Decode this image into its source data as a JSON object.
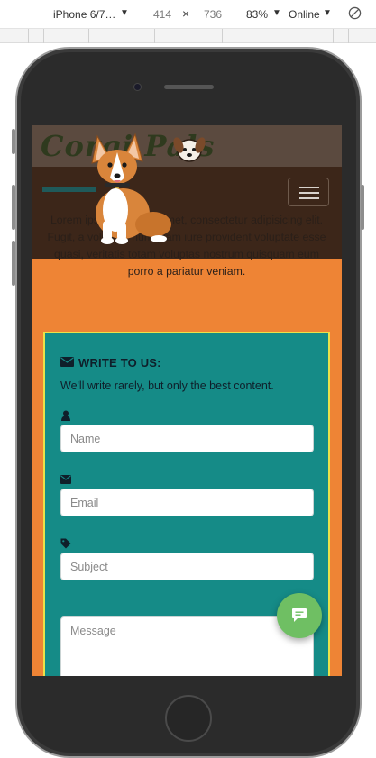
{
  "devtools": {
    "device": "iPhone 6/7…",
    "width": "414",
    "separator": "×",
    "height": "736",
    "zoom": "83%",
    "network": "Online",
    "caret": "▼"
  },
  "site": {
    "logo_text": "Corgi Pals",
    "hero_text": "Lorem ipsum dolor sit amet, consectetur adipisicing elit. Fugit, a voluptas numquam iure provident voluptate esse quasi, veritatis totam voluptas nostrum quisquam eum porro a pariatur veniam."
  },
  "contact": {
    "title": "WRITE TO US:",
    "subtitle": "We'll write rarely, but only the best content.",
    "fields": {
      "name_placeholder": "Name",
      "email_placeholder": "Email",
      "subject_placeholder": "Subject",
      "message_placeholder": "Message"
    }
  },
  "colors": {
    "page_bg": "#ee8435",
    "card_bg": "#158b87",
    "card_border": "#e9e24a",
    "chat_button": "#6fbf63"
  },
  "icons": {
    "user": "user-icon",
    "envelope": "envelope-icon",
    "tag": "tag-icon",
    "chat": "chat-icon",
    "menu": "hamburger-menu-icon"
  }
}
